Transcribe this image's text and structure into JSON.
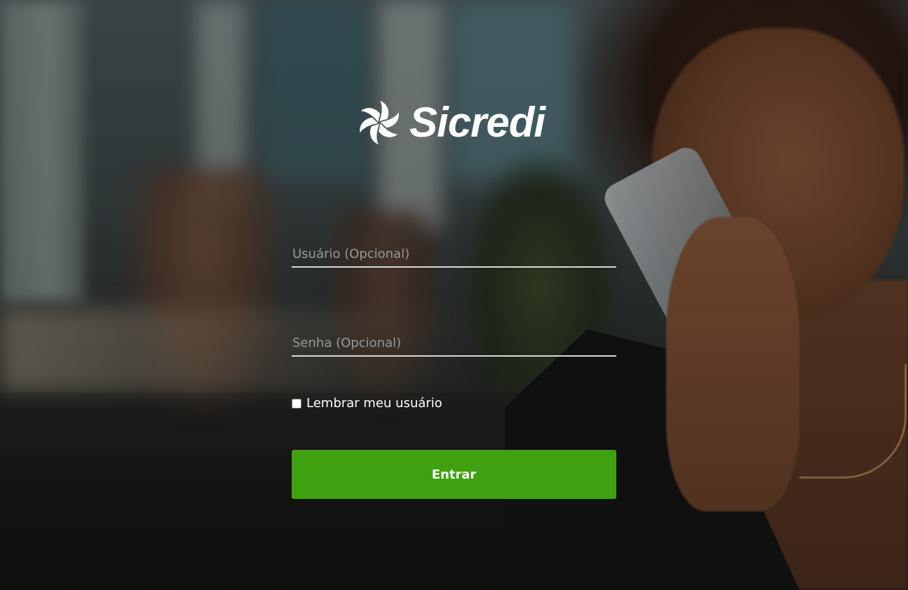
{
  "brand": {
    "name": "Sicredi",
    "logo_icon": "sicredi-swirl-icon"
  },
  "form": {
    "username_placeholder": "Usuário (Opcional)",
    "username_value": "",
    "password_placeholder": "Senha (Opcional)",
    "password_value": "",
    "remember_label": "Lembrar meu usuário",
    "remember_checked": false,
    "submit_label": "Entrar"
  },
  "colors": {
    "accent": "#3fa110",
    "text": "#ffffff",
    "underline": "#d8d8d8"
  }
}
